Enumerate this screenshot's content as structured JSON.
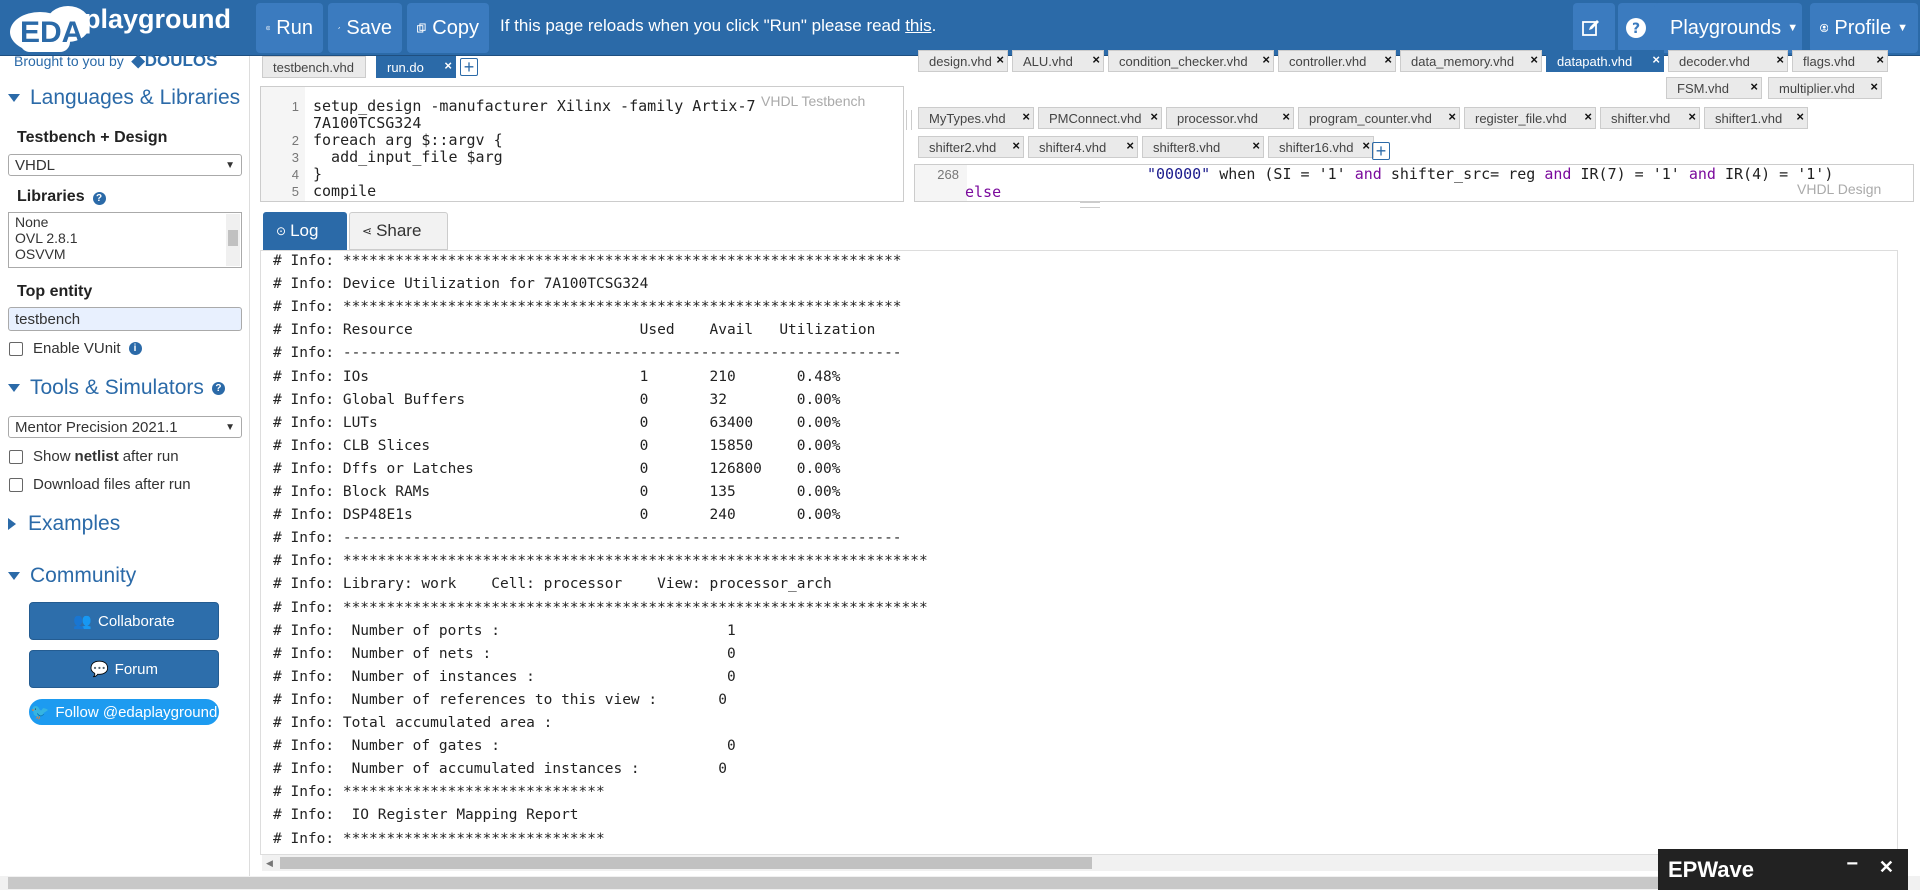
{
  "header": {
    "logo_eda": "EDA",
    "logo_playground": "playground",
    "run_label": "Run",
    "save_label": "Save",
    "copy_label": "Copy",
    "reload_msg": "If this page reloads when you click \"Run\" please read ",
    "reload_link": "this",
    "reload_end": ".",
    "playgrounds_label": "Playgrounds",
    "profile_label": "Profile"
  },
  "sidebar": {
    "brought_by": "Brought to you by",
    "brand": "DOULOS",
    "languages_head": "Languages & Libraries",
    "testbench_label": "Testbench + Design",
    "language_value": "VHDL",
    "libraries_label": "Libraries",
    "libraries": [
      "None",
      "OVL 2.8.1",
      "OSVVM"
    ],
    "top_entity_label": "Top entity",
    "top_entity_value": "testbench",
    "enable_vunit": "Enable VUnit",
    "tools_head": "Tools & Simulators",
    "tool_value": "Mentor Precision 2021.1",
    "show_netlist_pre": "Show ",
    "show_netlist_bold": "netlist",
    "show_netlist_post": " after run",
    "download_files": "Download files after run",
    "examples_head": "Examples",
    "community_head": "Community",
    "collaborate": "Collaborate",
    "forum": "Forum",
    "follow": "Follow @edaplayground"
  },
  "left_editor": {
    "tabs": [
      "testbench.vhd",
      "run.do"
    ],
    "tag": "VHDL Testbench",
    "lines": [
      {
        "n": "1",
        "text": "setup_design -manufacturer Xilinx -family Artix-7"
      },
      {
        "n": "",
        "text": "7A100TCSG324"
      },
      {
        "n": "2",
        "text": "foreach arg $::argv {"
      },
      {
        "n": "3",
        "text": "  add_input_file $arg"
      },
      {
        "n": "4",
        "text": "}"
      },
      {
        "n": "5",
        "text": "compile"
      }
    ]
  },
  "right_editor": {
    "tabs_row1": [
      "design.vhd",
      "ALU.vhd",
      "condition_checker.vhd",
      "controller.vhd",
      "data_memory.vhd",
      "datapath.vhd",
      "decoder.vhd",
      "flags.vhd"
    ],
    "tabs_row2": [
      "FSM.vhd",
      "multiplier.vhd"
    ],
    "tabs_row3": [
      "MyTypes.vhd",
      "PMConnect.vhd",
      "processor.vhd",
      "program_counter.vhd",
      "register_file.vhd",
      "shifter.vhd",
      "shifter1.vhd"
    ],
    "tabs_row4": [
      "shifter2.vhd",
      "shifter4.vhd",
      "shifter8.vhd",
      "shifter16.vhd"
    ],
    "tag": "VHDL Design",
    "line_no": "268",
    "code_line1_a": "\"00000\"",
    "code_line1_b": " when (SI = '1' ",
    "code_line1_c": "and",
    "code_line1_d": " shifter_src= reg ",
    "code_line1_e": "and",
    "code_line1_f": " IR(7) = '1' ",
    "code_line1_g": "and",
    "code_line1_h": " IR(4) = '1')",
    "code_line2": "else"
  },
  "log": {
    "log_tab": "Log",
    "share_tab": "Share",
    "lines": [
      "# Info: ****************************************************************",
      "# Info: Device Utilization for 7A100TCSG324",
      "# Info: ****************************************************************",
      "# Info: Resource                          Used    Avail   Utilization",
      "# Info: ----------------------------------------------------------------",
      "# Info: IOs                               1       210       0.48%",
      "# Info: Global Buffers                    0       32        0.00%",
      "# Info: LUTs                              0       63400     0.00%",
      "# Info: CLB Slices                        0       15850     0.00%",
      "# Info: Dffs or Latches                   0       126800    0.00%",
      "# Info: Block RAMs                        0       135       0.00%",
      "# Info: DSP48E1s                          0       240       0.00%",
      "# Info: ----------------------------------------------------------------",
      "# Info: *******************************************************************",
      "# Info: Library: work    Cell: processor    View: processor_arch",
      "# Info: *******************************************************************",
      "# Info:  Number of ports :                          1",
      "# Info:  Number of nets :                           0",
      "# Info:  Number of instances :                      0",
      "# Info:  Number of references to this view :       0",
      "# Info: Total accumulated area :",
      "# Info:  Number of gates :                          0",
      "# Info:  Number of accumulated instances :         0",
      "# Info: ******************************",
      "# Info:  IO Register Mapping Report",
      "# Info: ******************************"
    ]
  },
  "epwave": {
    "title": "EPWave",
    "minimize": "−",
    "close": "✕"
  }
}
